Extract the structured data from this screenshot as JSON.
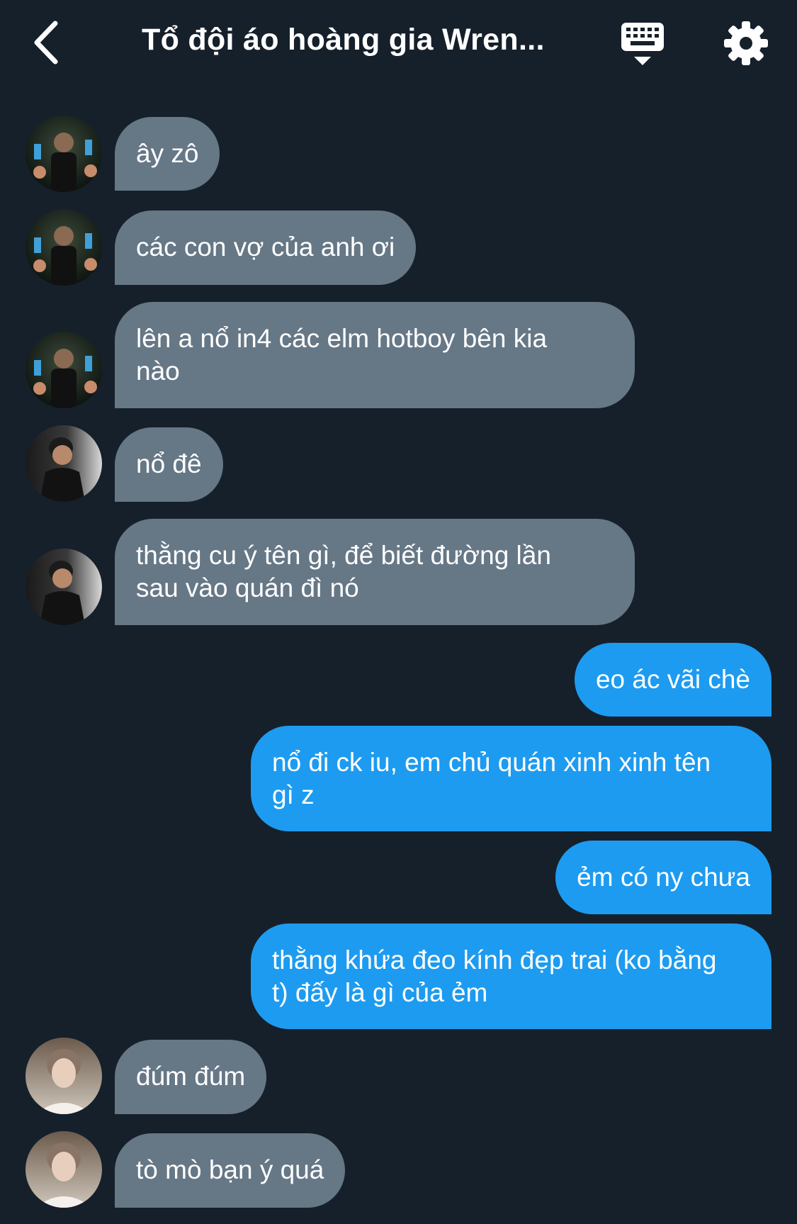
{
  "header": {
    "title": "Tổ đội áo hoàng gia Wren...",
    "back_icon": "chevron-left-icon",
    "keyboard_icon": "keyboard-icon",
    "settings_icon": "gear-icon"
  },
  "colors": {
    "background": "#16202b",
    "incoming_bubble": "#667786",
    "outgoing_bubble": "#1d9bf0",
    "text": "#ffffff"
  },
  "messages": [
    {
      "direction": "incoming",
      "avatar": "avatar-a",
      "text": "ây zô"
    },
    {
      "direction": "incoming",
      "avatar": "avatar-a",
      "text": "các con vợ của anh ơi"
    },
    {
      "direction": "incoming",
      "avatar": "avatar-a",
      "line1": "lên a nổ in4 các elm hotboy bên kia",
      "line2": "nào"
    },
    {
      "direction": "incoming",
      "avatar": "avatar-b",
      "text": "nổ đê"
    },
    {
      "direction": "incoming",
      "avatar": "avatar-b",
      "line1": "thằng cu ý tên gì, để biết đường lần",
      "line2": "sau vào quán đì nó"
    },
    {
      "direction": "outgoing",
      "text": "eo ác vãi chè"
    },
    {
      "direction": "outgoing",
      "line1": "nổ đi ck iu, em chủ quán xinh xinh tên",
      "line2": "gì z"
    },
    {
      "direction": "outgoing",
      "text": "ẻm có ny chưa"
    },
    {
      "direction": "outgoing",
      "line1": "thằng khứa đeo kính đẹp trai (ko bằng",
      "line2": "t) đấy là gì của ẻm"
    },
    {
      "direction": "incoming",
      "avatar": "avatar-c",
      "text": "đúm đúm"
    },
    {
      "direction": "incoming",
      "avatar": "avatar-c",
      "text": "tò mò bạn ý quá"
    }
  ]
}
